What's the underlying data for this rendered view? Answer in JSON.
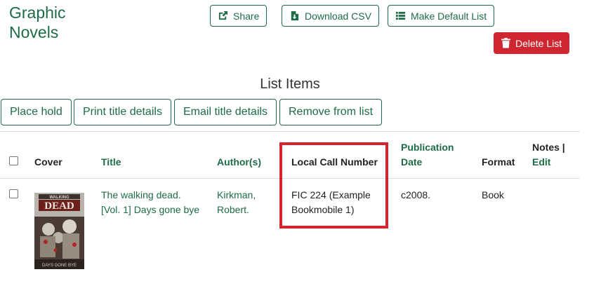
{
  "list_title": "Graphic Novels",
  "toolbar": {
    "share_label": "Share",
    "download_csv_label": "Download CSV",
    "make_default_label": "Make Default List",
    "delete_list_label": "Delete List"
  },
  "section_heading": "List Items",
  "actions": {
    "place_hold": "Place hold",
    "print_title_details": "Print title details",
    "email_title_details": "Email title details",
    "remove_from_list": "Remove from list"
  },
  "table": {
    "headers": {
      "cover": "Cover",
      "title": "Title",
      "authors": "Author(s)",
      "local_call_number": "Local Call Number",
      "publication_date_1": "Publication",
      "publication_date_2": "Date",
      "format": "Format",
      "notes": "Notes |",
      "edit": "Edit"
    },
    "rows": [
      {
        "title_line1": "The walking dead.",
        "title_line2": "[Vol. 1] Days gone bye",
        "author_line1": "Kirkman,",
        "author_line2": "Robert.",
        "call_number_line1": "FIC 224 (Example",
        "call_number_line2": "Bookmobile 1)",
        "publication_date": "c2008.",
        "format": "Book",
        "notes": "",
        "cover_logo_text": "THE WALKING DEAD",
        "cover_subtitle_text": "DAYS GONE BYE"
      }
    ]
  },
  "colors": {
    "brand_green": "#1e6b47",
    "danger_red": "#cf2630",
    "highlight_red": "#d6232e"
  }
}
